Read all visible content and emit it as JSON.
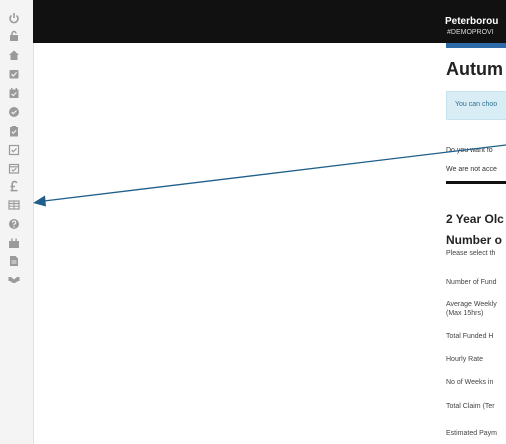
{
  "header": {
    "org_name": "Peterborou",
    "org_code": "#DEMOPROVI"
  },
  "main": {
    "title": "Autum",
    "info_text": "You can choo",
    "question_text": "Do you want fo",
    "notice_text": "We are not acce",
    "section_title": "2 Year Olc",
    "subsection_title": "Number o",
    "section_desc": "Please select th",
    "rows": [
      "Number of Fund",
      "Average Weekly\n(Max 15hrs)",
      "Total Funded H",
      "Hourly Rate",
      "No of Weeks in",
      "Total Claim (Ter",
      "Estimated Paym"
    ]
  },
  "sidebar": {
    "icons": [
      "power-icon",
      "lock-icon",
      "home-icon",
      "inbox-icon",
      "calendar-check-icon",
      "check-circle-icon",
      "clipboard-icon",
      "checkbox-icon",
      "calendar-icon",
      "pound-icon",
      "table-icon",
      "help-icon",
      "briefcase-icon",
      "document-icon",
      "handshake-icon"
    ]
  },
  "colors": {
    "topbar": "#111111",
    "accent": "#2d6aa8",
    "info_bg": "#d9edf7",
    "arrow": "#1f5f8a"
  }
}
